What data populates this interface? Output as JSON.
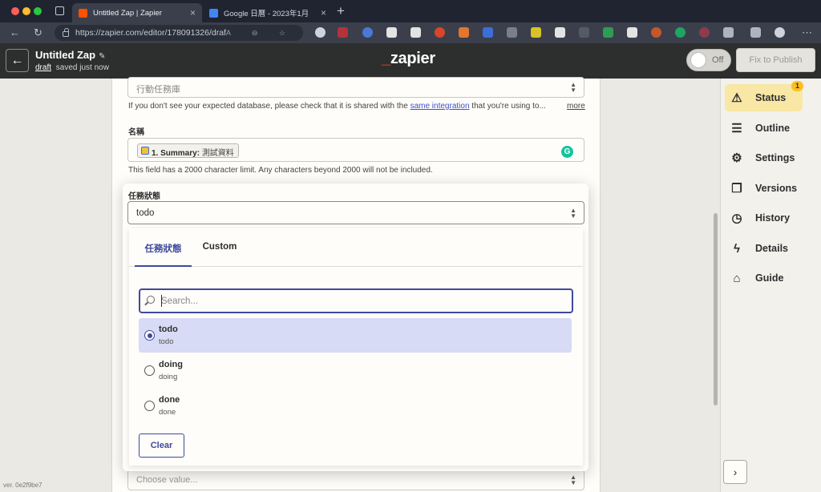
{
  "browser": {
    "tabs": [
      {
        "title": "Untitled Zap | Zapier",
        "active": true
      },
      {
        "title": "Google 日曆 - 2023年1月",
        "active": false
      }
    ],
    "url": "https://zapier.com/editor/178091326/draft/..."
  },
  "header": {
    "zap_title": "Untitled Zap",
    "draft_link": "draft",
    "save_status": "saved just now",
    "logo": "zapier",
    "toggle_label": "Off",
    "publish_label": "Fix to Publish"
  },
  "form": {
    "database_value": "行動任務庫",
    "database_help": "If you don't see your expected database, please check that it is shared with the",
    "database_help_link": "same integration",
    "database_help_tail": "that you're using to...",
    "more_link": "more",
    "name_label": "名稱",
    "name_pill_step": "1. Summary:",
    "name_pill_value": "測試資料",
    "name_help": "This field has a 2000 character limit. Any characters beyond 2000 will not be included.",
    "status_label": "任務狀態",
    "status_value": "todo",
    "bottom_placeholder": "Choose value..."
  },
  "dropdown": {
    "tabs": [
      "任務狀態",
      "Custom"
    ],
    "search_placeholder": "Search...",
    "options": [
      {
        "label": "todo",
        "value": "todo",
        "selected": true
      },
      {
        "label": "doing",
        "value": "doing",
        "selected": false
      },
      {
        "label": "done",
        "value": "done",
        "selected": false
      }
    ],
    "clear_label": "Clear"
  },
  "sidebar": {
    "items": [
      {
        "label": "Status",
        "icon": "warning-icon"
      },
      {
        "label": "Outline",
        "icon": "list-icon"
      },
      {
        "label": "Settings",
        "icon": "gear-icon"
      },
      {
        "label": "Versions",
        "icon": "versions-icon"
      },
      {
        "label": "History",
        "icon": "clock-icon"
      },
      {
        "label": "Details",
        "icon": "file-bolt-icon"
      },
      {
        "label": "Guide",
        "icon": "graduation-cap-icon"
      }
    ],
    "status_badge": "1"
  },
  "footer": {
    "version": "ver. 0e2f9be7"
  }
}
